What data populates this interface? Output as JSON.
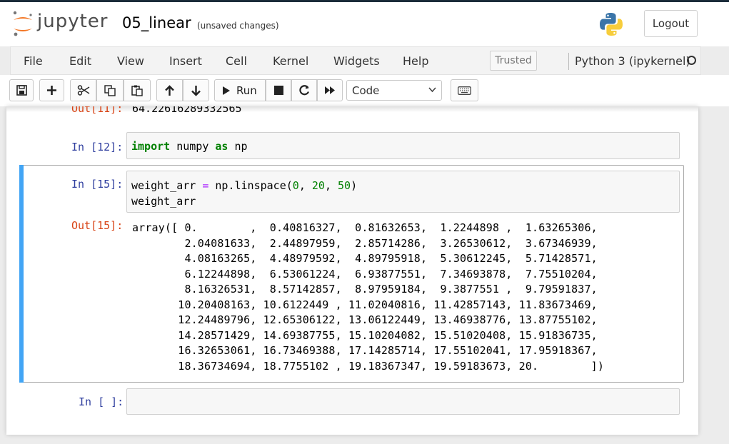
{
  "header": {
    "brand": "jupyter",
    "notebook_name": "05_linear",
    "save_status": "(unsaved changes)",
    "logout_label": "Logout"
  },
  "menubar": {
    "items": [
      "File",
      "Edit",
      "View",
      "Insert",
      "Cell",
      "Kernel",
      "Widgets",
      "Help"
    ],
    "trusted_label": "Trusted",
    "kernel_name": "Python 3 (ipykernel)"
  },
  "toolbar": {
    "run_label": "Run",
    "cell_type": "Code"
  },
  "cells": {
    "prev_output": {
      "prompt": "Out[11]:",
      "text": "64.22616289332565"
    },
    "cell12": {
      "prompt": "In [12]:",
      "code_kw1": "import",
      "code_mid": " numpy ",
      "code_kw2": "as",
      "code_end": " np"
    },
    "cell15": {
      "prompt": "In [15]:",
      "line1_a": "weight_arr ",
      "line1_op": "=",
      "line1_b": " np.linspace(",
      "line1_n1": "0",
      "line1_c": ", ",
      "line1_n2": "20",
      "line1_d": ", ",
      "line1_n3": "50",
      "line1_e": ")",
      "line2": "weight_arr",
      "out_prompt": "Out[15]:",
      "output": "array([ 0.        ,  0.40816327,  0.81632653,  1.2244898 ,  1.63265306,\n        2.04081633,  2.44897959,  2.85714286,  3.26530612,  3.67346939,\n        4.08163265,  4.48979592,  4.89795918,  5.30612245,  5.71428571,\n        6.12244898,  6.53061224,  6.93877551,  7.34693878,  7.75510204,\n        8.16326531,  8.57142857,  8.97959184,  9.3877551 ,  9.79591837,\n       10.20408163, 10.6122449 , 11.02040816, 11.42857143, 11.83673469,\n       12.24489796, 12.65306122, 13.06122449, 13.46938776, 13.87755102,\n       14.28571429, 14.69387755, 15.10204082, 15.51020408, 15.91836735,\n       16.32653061, 16.73469388, 17.14285714, 17.55102041, 17.95918367,\n       18.36734694, 18.7755102 , 19.18367347, 19.59183673, 20.        ])"
    },
    "empty_cell": {
      "prompt": "In [ ]:"
    }
  }
}
